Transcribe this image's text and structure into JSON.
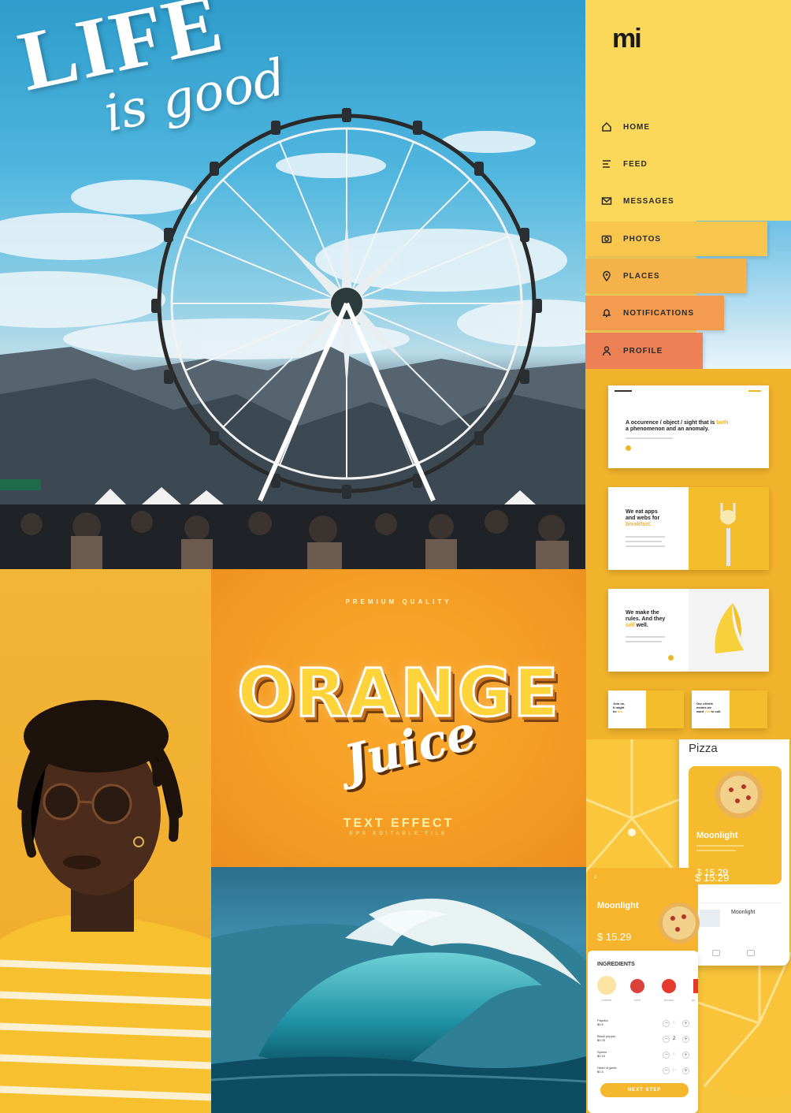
{
  "ferris_tile": {
    "title": "LIFE",
    "subtitle": "is good"
  },
  "menu": {
    "logo": "mi",
    "items": [
      {
        "label": "HOME",
        "icon": "home-icon"
      },
      {
        "label": "FEED",
        "icon": "feed-icon"
      },
      {
        "label": "MESSAGES",
        "icon": "mail-icon"
      },
      {
        "label": "PHOTOS",
        "icon": "camera-icon"
      },
      {
        "label": "PLACES",
        "icon": "pin-icon"
      },
      {
        "label": "NOTIFICATIONS",
        "icon": "bell-icon"
      },
      {
        "label": "PROFILE",
        "icon": "user-icon"
      }
    ],
    "band_colors": [
      "#f9c64d",
      "#f6b24a",
      "#f39c4f",
      "#ee8055"
    ]
  },
  "web_templates": {
    "card1": {
      "line1": "A occurence / object / sight that is",
      "highlight": "both",
      "line2": "a phenomenon and an anomaly."
    },
    "card2": {
      "line1": "We eat apps",
      "line2": "and webs for",
      "highlight": "breakfast."
    },
    "card3": {
      "line1": "We make the",
      "line2": "rules. And they",
      "highlight": "sell",
      "line3": "well."
    },
    "card4": {
      "line1": "Join us,",
      "line2": "it might",
      "line3": "be",
      "highlight": "fun."
    },
    "card5": {
      "line1": "Our clients",
      "line2": "means we",
      "line3": "want",
      "highlight": "you",
      "line4": "to call."
    }
  },
  "orange_juice": {
    "premium": "PREMIUM QUALITY",
    "title": "ORANGE",
    "script": "Juice",
    "effect": "TEXT EFFECT",
    "eps": "EPS EDITABLE FILE"
  },
  "pizza_app": {
    "header": "Pizza",
    "name": "Moonlight",
    "price": "$ 15.29",
    "price_small": "$ 15.29",
    "detail_name": "Moonlight",
    "detail_price": "$ 15.29",
    "map_name": "Moonlight",
    "ingredients_title": "INGREDIENTS",
    "ingredients": [
      "cheese",
      "beef",
      "tomato",
      "pe"
    ],
    "rows": [
      {
        "name": "Paprika",
        "price": "$0.5",
        "qty": "0"
      },
      {
        "name": "Black pepper",
        "price": "$0.25",
        "qty": "2"
      },
      {
        "name": "Spices",
        "price": "$0.15",
        "qty": "0"
      },
      {
        "name": "Head of garlic",
        "price": "$0.3",
        "qty": "0"
      }
    ],
    "cta": "NEXT STEP"
  }
}
